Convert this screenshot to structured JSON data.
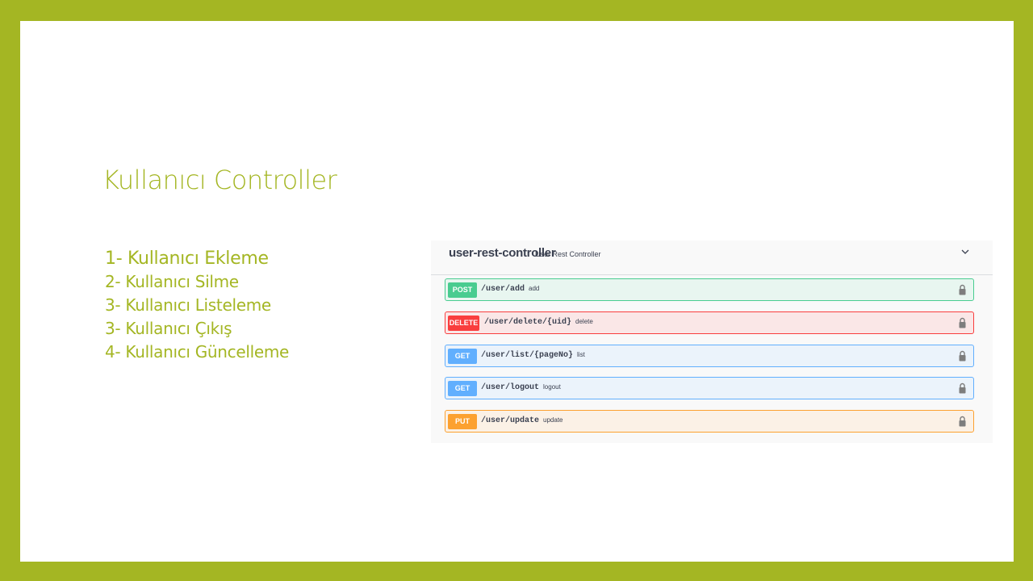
{
  "slide": {
    "title": "Kullanıcı Controller",
    "items": [
      "1- Kullanıcı Ekleme",
      "2- Kullanıcı Silme",
      "3- Kullanıcı Listeleme",
      "3- Kullanıcı Çıkış",
      "4- Kullanıcı Güncelleme"
    ]
  },
  "swagger": {
    "controller_name": "user-rest-controller",
    "controller_desc": "User Rest Controller",
    "operations": [
      {
        "method": "POST",
        "path": "/user/add",
        "summary": "add"
      },
      {
        "method": "DELETE",
        "path": "/user/delete/{uid}",
        "summary": "delete"
      },
      {
        "method": "GET",
        "path": "/user/list/{pageNo}",
        "summary": "list"
      },
      {
        "method": "GET",
        "path": "/user/logout",
        "summary": "logout"
      },
      {
        "method": "PUT",
        "path": "/user/update",
        "summary": "update"
      }
    ]
  },
  "colors": {
    "frame": "#a4b623",
    "post": "#49cc90",
    "delete": "#f93e3e",
    "get": "#61affe",
    "put": "#fca130"
  },
  "icons": {
    "lock": "lock-icon",
    "chevron": "chevron-down-icon"
  }
}
